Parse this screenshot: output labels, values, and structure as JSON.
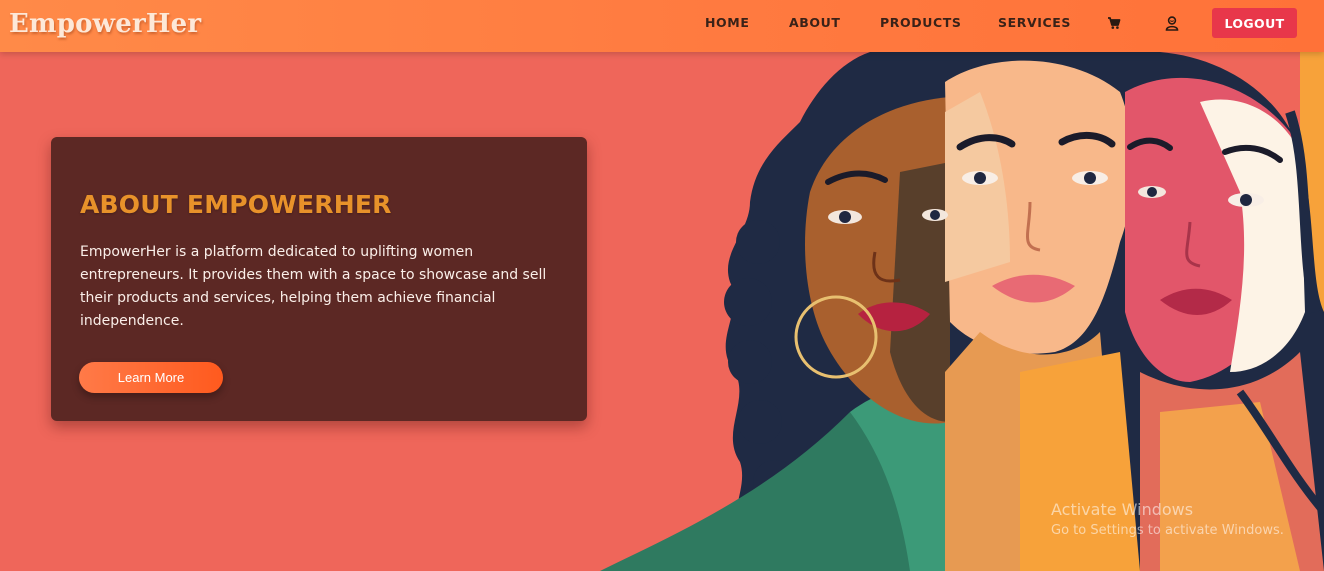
{
  "nav": {
    "brand": "EmpowerHer",
    "links": [
      "HOME",
      "ABOUT",
      "PRODUCTS",
      "SERVICES"
    ],
    "icons": [
      "cart-icon",
      "user-icon"
    ],
    "logout": "LOGOUT",
    "colors": {
      "bar": "#ff7a40",
      "logout": "#e8374a"
    }
  },
  "about": {
    "title": "ABOUT EMPOWERHER",
    "text": "EmpowerHer is a platform dedicated to uplifting women entrepreneurs. It provides them with a space to showcase and sell their products and services, helping them achieve financial independence.",
    "button": "Learn More",
    "colors": {
      "card": "#5c2824",
      "title": "#e8922a",
      "background": "#ef665a"
    }
  },
  "watermark": {
    "title": "Activate Windows",
    "subtitle": "Go to Settings to activate Windows."
  }
}
